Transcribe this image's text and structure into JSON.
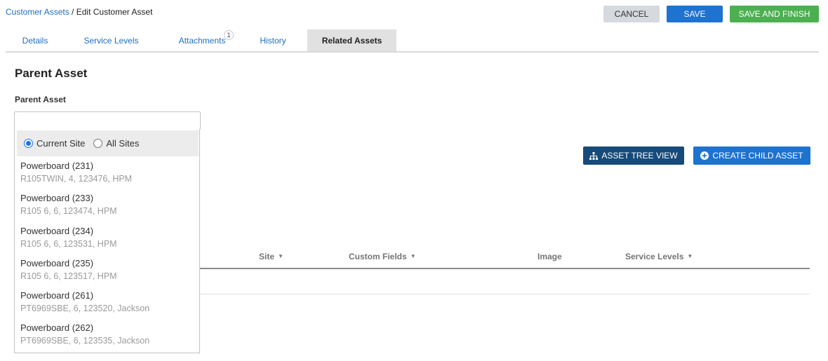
{
  "breadcrumb": {
    "parent": "Customer Assets",
    "separator": " / ",
    "current": "Edit Customer Asset"
  },
  "actions": {
    "cancel": "CANCEL",
    "save": "SAVE",
    "save_finish": "SAVE AND FINISH"
  },
  "tabs": [
    {
      "label": "Details"
    },
    {
      "label": "Service Levels"
    },
    {
      "label": "Attachments",
      "badge": "1"
    },
    {
      "label": "History"
    },
    {
      "label": "Related Assets"
    }
  ],
  "section": {
    "title": "Parent Asset",
    "field_label": "Parent Asset",
    "input_value": ""
  },
  "radios": {
    "current_site": "Current Site",
    "all_sites": "All Sites",
    "selected": "current_site"
  },
  "options": [
    {
      "title": "Powerboard (231)",
      "sub": "R105TWIN, 4, 123476, HPM"
    },
    {
      "title": "Powerboard (233)",
      "sub": "R105 6, 6, 123474, HPM"
    },
    {
      "title": "Powerboard (234)",
      "sub": "R105 6, 6, 123531, HPM"
    },
    {
      "title": "Powerboard (235)",
      "sub": "R105 6, 6, 123517, HPM"
    },
    {
      "title": "Powerboard (261)",
      "sub": "PT6969SBE, 6, 123520, Jackson"
    },
    {
      "title": "Powerboard (262)",
      "sub": "PT6969SBE, 6, 123535, Jackson"
    }
  ],
  "buttons": {
    "tree_view": "ASSET TREE VIEW",
    "create_child": "CREATE CHILD ASSET"
  },
  "table": {
    "site": "Site",
    "custom_fields": "Custom Fields",
    "image": "Image",
    "service_levels": "Service Levels"
  },
  "colors": {
    "link": "#1e6fc2",
    "primary": "#1e72d0",
    "success": "#4cb050",
    "dark": "#164a7a"
  }
}
